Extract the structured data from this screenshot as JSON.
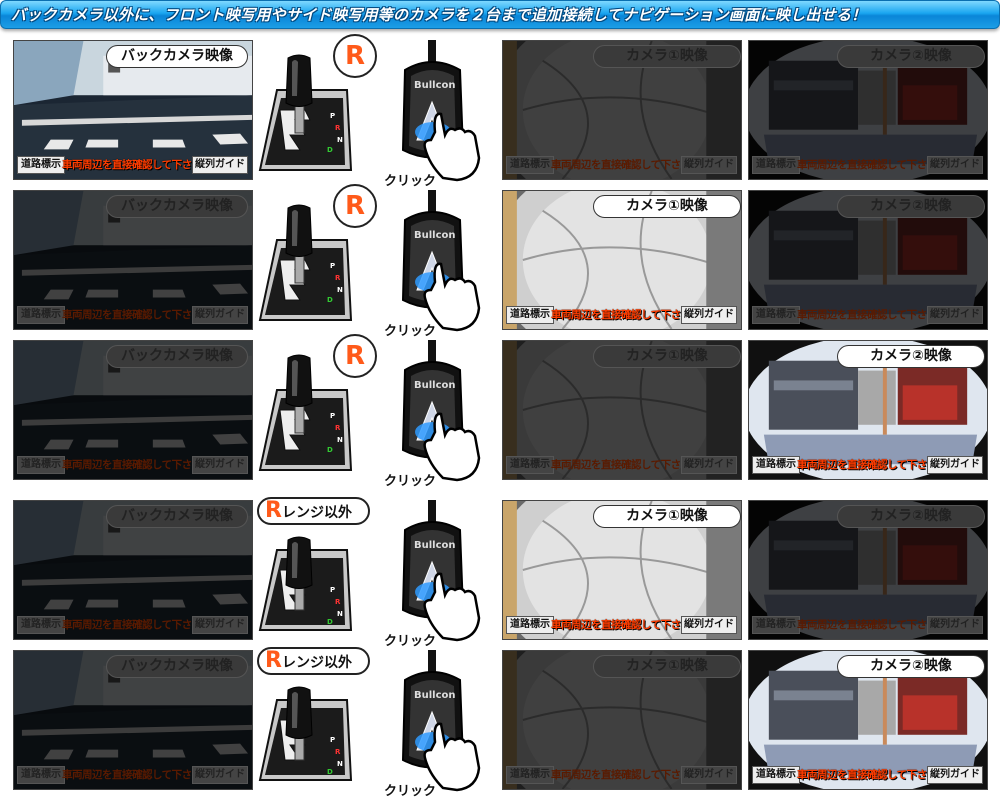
{
  "banner": {
    "text": "バックカメラ以外に、フロント映写用やサイド映写用等のカメラを２台まで追加接続してナビゲーション画面に映し出せる！"
  },
  "common": {
    "back_label": "バックカメラ映像",
    "cam1_label": "カメラ①映像",
    "cam2_label": "カメラ②映像",
    "road_btn": "道路標示",
    "warning": "車両周辺を直接確認して下さい",
    "guide_btn": "縦列ガイド",
    "click_label": "クリック",
    "brand": "Bullcon",
    "r_glyph": "R",
    "not_r_text": "レンジ以外",
    "gear_letters": [
      "P",
      "R",
      "N",
      "D"
    ]
  },
  "rows": [
    {
      "active": "back",
      "gear": "R"
    },
    {
      "active": "cam1",
      "gear": "R"
    },
    {
      "active": "cam2",
      "gear": "R"
    },
    {
      "active": "cam1",
      "gear": "not_r"
    },
    {
      "active": "cam2",
      "gear": "not_r"
    }
  ],
  "colors": {
    "banner_top": "#7fd8ff",
    "banner_bottom": "#0a86d8",
    "r_orange": "#ff5a1a",
    "warning_red": "#ff3c00",
    "led_blue": "#2f9bff"
  }
}
